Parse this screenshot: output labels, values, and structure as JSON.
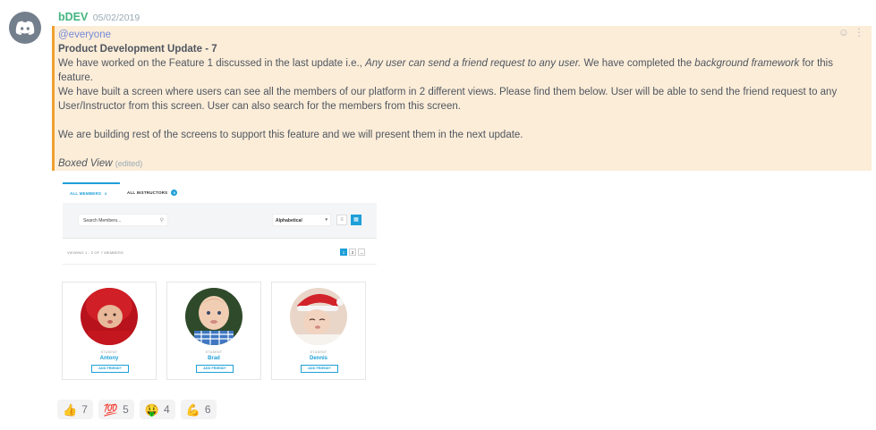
{
  "message": {
    "username": "bDEV",
    "timestamp": "05/02/2019",
    "mention": "@everyone",
    "title": "Product Development Update - 7",
    "line1_pre": "We have worked on the  Feature 1 discussed in the last update i.e., ",
    "line1_em1": "Any user can send a friend request to any user.",
    "line1_mid": " We have completed the ",
    "line1_em2": "background framework",
    "line1_post": " for this feature.",
    "line2": " We have built a screen where users can see all the members of our platform in 2 different views. Please find them below. User will be able to send the friend request to any User/Instructor from this screen. User can also search for the members from this screen.",
    "line3": " We are building rest of the screens to support this feature and we will present them in the next update.",
    "caption": "Boxed View",
    "edited": "(edited)"
  },
  "embed": {
    "tabs": [
      {
        "label": "ALL MEMBERS",
        "count": "6"
      },
      {
        "label": "ALL INSTRUCTORS",
        "count": "0"
      }
    ],
    "search_placeholder": "Search Members...",
    "sort_value": "Alphabetical",
    "viewing_text": "VIEWING 1 - 3 OF 7 MEMBERS",
    "pages": [
      "1",
      "2",
      "→"
    ],
    "members": [
      {
        "role": "STUDENT",
        "name": "Antony",
        "button": "ADD FRIEND+"
      },
      {
        "role": "STUDENT",
        "name": "Brad",
        "button": "ADD FRIEND+"
      },
      {
        "role": "STUDENT",
        "name": "Dennis",
        "button": "ADD FRIEND+"
      }
    ]
  },
  "reactions": [
    {
      "emoji": "👍",
      "count": "7",
      "icon": "thumbs-up-icon"
    },
    {
      "emoji": "💯",
      "count": "5",
      "icon": "hundred-points-icon"
    },
    {
      "emoji": "🤑",
      "count": "4",
      "icon": "money-mouth-face-icon"
    },
    {
      "emoji": "💪",
      "count": "6",
      "icon": "flexed-biceps-icon"
    }
  ],
  "colors": {
    "username": "#43b581",
    "mention": "#7289da",
    "highlight": "#fcedd8",
    "highlight_border": "#f0a030",
    "accent": "#1e9fd8"
  }
}
